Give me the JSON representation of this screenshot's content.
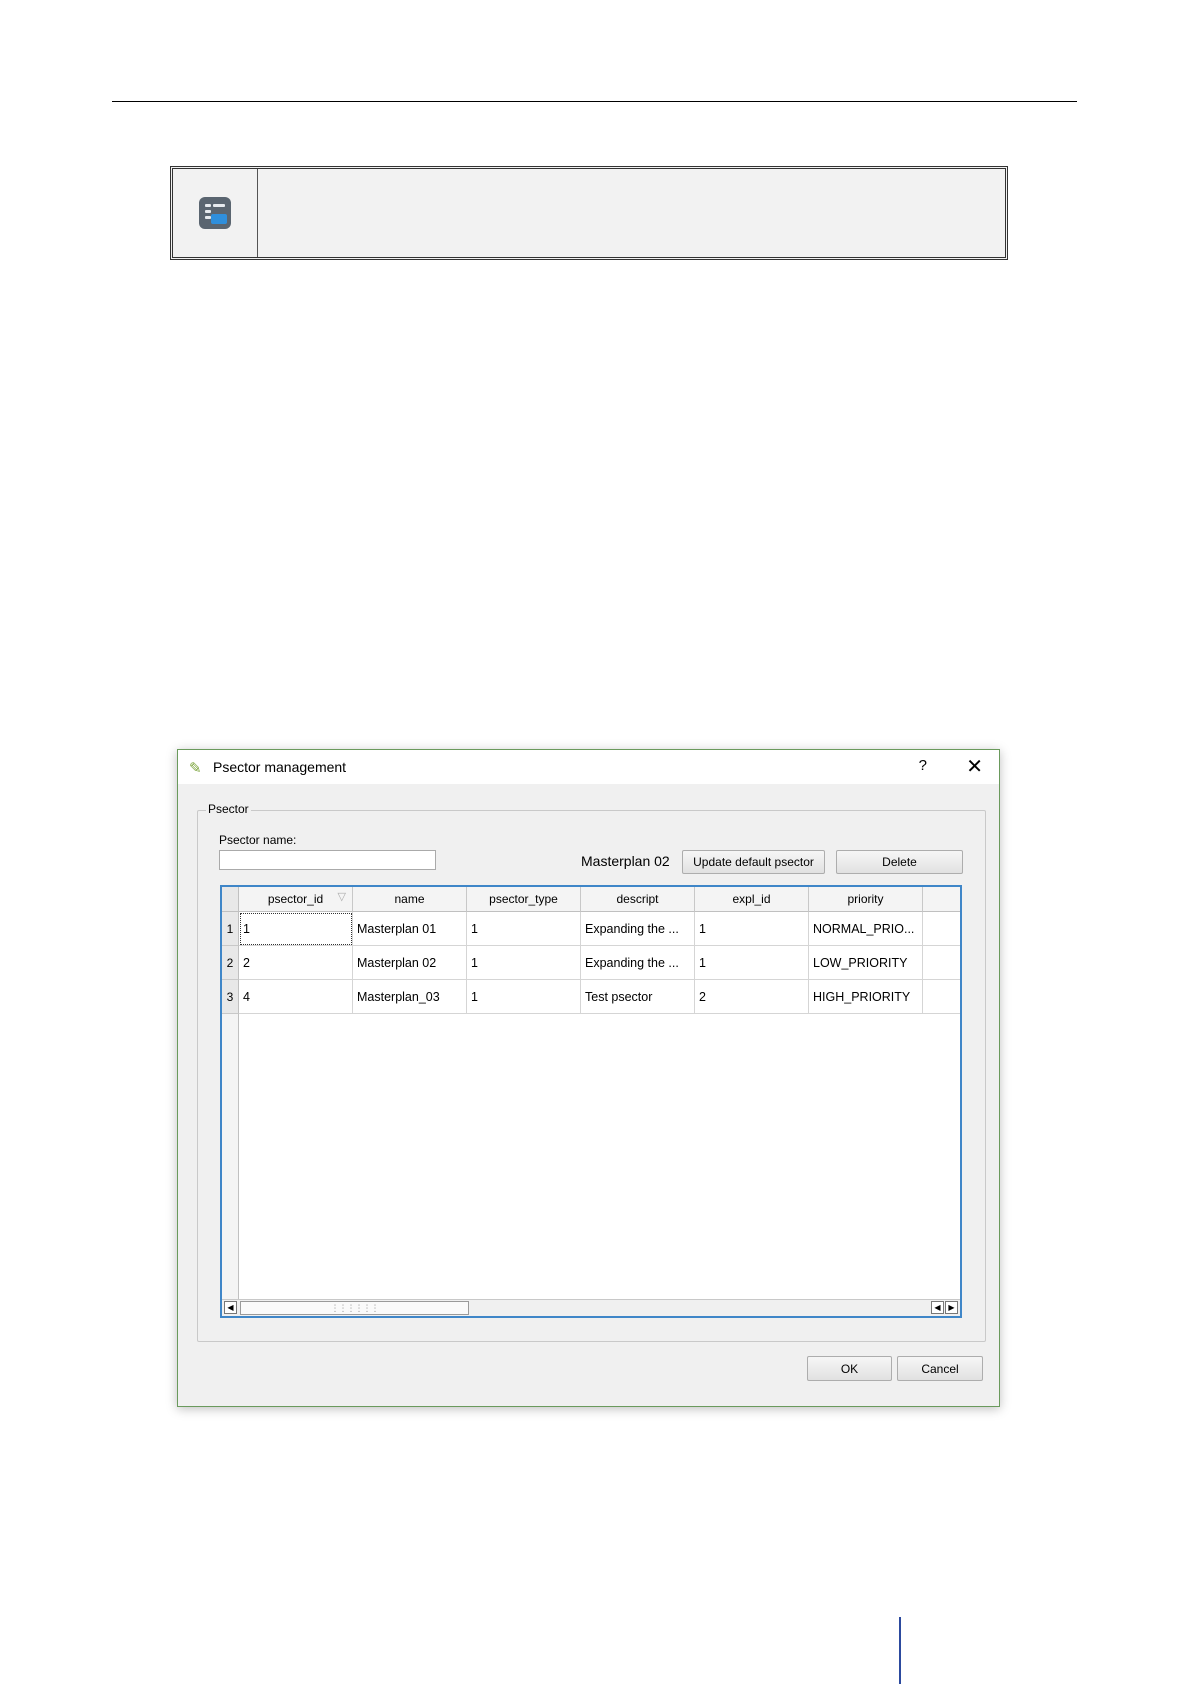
{
  "dialog": {
    "title": "Psector management",
    "help_label": "?",
    "close_label": "✕",
    "group_label": "Psector",
    "psector_name_label": "Psector name:",
    "psector_name_value": "",
    "current_psector": "Masterplan 02",
    "update_button": "Update default psector",
    "delete_button": "Delete",
    "ok_button": "OK",
    "cancel_button": "Cancel"
  },
  "table": {
    "columns": [
      "psector_id",
      "name",
      "psector_type",
      "descript",
      "expl_id",
      "priority"
    ],
    "rows": [
      {
        "row_num": "1",
        "cells": [
          "1",
          "Masterplan 01",
          "1",
          "Expanding the ...",
          "1",
          "NORMAL_PRIO..."
        ]
      },
      {
        "row_num": "2",
        "cells": [
          "2",
          "Masterplan 02",
          "1",
          "Expanding the ...",
          "1",
          "LOW_PRIORITY"
        ]
      },
      {
        "row_num": "3",
        "cells": [
          "4",
          "Masterplan_03",
          "1",
          "Test psector",
          "2",
          "HIGH_PRIORITY"
        ]
      }
    ]
  },
  "icons": {
    "app_icon": "psector-list-icon",
    "title_icon": "qgis-icon",
    "sort_icon": "sort-indicator-icon"
  },
  "colors": {
    "table_focus_border": "#3f86c8",
    "dialog_border": "#6a9a5c",
    "page_marker": "#2c4a9e"
  }
}
